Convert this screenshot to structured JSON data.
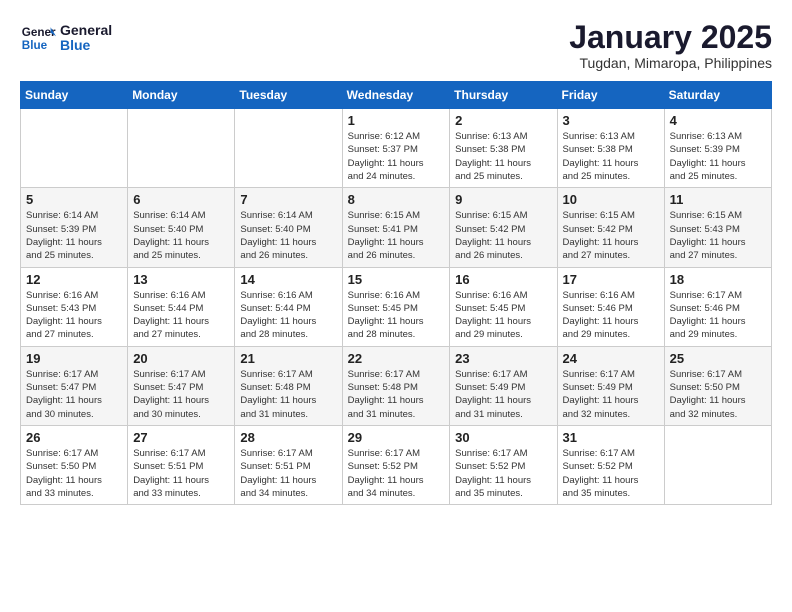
{
  "header": {
    "logo_line1": "General",
    "logo_line2": "Blue",
    "calendar_title": "January 2025",
    "calendar_subtitle": "Tugdan, Mimaropa, Philippines"
  },
  "weekdays": [
    "Sunday",
    "Monday",
    "Tuesday",
    "Wednesday",
    "Thursday",
    "Friday",
    "Saturday"
  ],
  "weeks": [
    [
      {
        "day": "",
        "info": ""
      },
      {
        "day": "",
        "info": ""
      },
      {
        "day": "",
        "info": ""
      },
      {
        "day": "1",
        "info": "Sunrise: 6:12 AM\nSunset: 5:37 PM\nDaylight: 11 hours\nand 24 minutes."
      },
      {
        "day": "2",
        "info": "Sunrise: 6:13 AM\nSunset: 5:38 PM\nDaylight: 11 hours\nand 25 minutes."
      },
      {
        "day": "3",
        "info": "Sunrise: 6:13 AM\nSunset: 5:38 PM\nDaylight: 11 hours\nand 25 minutes."
      },
      {
        "day": "4",
        "info": "Sunrise: 6:13 AM\nSunset: 5:39 PM\nDaylight: 11 hours\nand 25 minutes."
      }
    ],
    [
      {
        "day": "5",
        "info": "Sunrise: 6:14 AM\nSunset: 5:39 PM\nDaylight: 11 hours\nand 25 minutes."
      },
      {
        "day": "6",
        "info": "Sunrise: 6:14 AM\nSunset: 5:40 PM\nDaylight: 11 hours\nand 25 minutes."
      },
      {
        "day": "7",
        "info": "Sunrise: 6:14 AM\nSunset: 5:40 PM\nDaylight: 11 hours\nand 26 minutes."
      },
      {
        "day": "8",
        "info": "Sunrise: 6:15 AM\nSunset: 5:41 PM\nDaylight: 11 hours\nand 26 minutes."
      },
      {
        "day": "9",
        "info": "Sunrise: 6:15 AM\nSunset: 5:42 PM\nDaylight: 11 hours\nand 26 minutes."
      },
      {
        "day": "10",
        "info": "Sunrise: 6:15 AM\nSunset: 5:42 PM\nDaylight: 11 hours\nand 27 minutes."
      },
      {
        "day": "11",
        "info": "Sunrise: 6:15 AM\nSunset: 5:43 PM\nDaylight: 11 hours\nand 27 minutes."
      }
    ],
    [
      {
        "day": "12",
        "info": "Sunrise: 6:16 AM\nSunset: 5:43 PM\nDaylight: 11 hours\nand 27 minutes."
      },
      {
        "day": "13",
        "info": "Sunrise: 6:16 AM\nSunset: 5:44 PM\nDaylight: 11 hours\nand 27 minutes."
      },
      {
        "day": "14",
        "info": "Sunrise: 6:16 AM\nSunset: 5:44 PM\nDaylight: 11 hours\nand 28 minutes."
      },
      {
        "day": "15",
        "info": "Sunrise: 6:16 AM\nSunset: 5:45 PM\nDaylight: 11 hours\nand 28 minutes."
      },
      {
        "day": "16",
        "info": "Sunrise: 6:16 AM\nSunset: 5:45 PM\nDaylight: 11 hours\nand 29 minutes."
      },
      {
        "day": "17",
        "info": "Sunrise: 6:16 AM\nSunset: 5:46 PM\nDaylight: 11 hours\nand 29 minutes."
      },
      {
        "day": "18",
        "info": "Sunrise: 6:17 AM\nSunset: 5:46 PM\nDaylight: 11 hours\nand 29 minutes."
      }
    ],
    [
      {
        "day": "19",
        "info": "Sunrise: 6:17 AM\nSunset: 5:47 PM\nDaylight: 11 hours\nand 30 minutes."
      },
      {
        "day": "20",
        "info": "Sunrise: 6:17 AM\nSunset: 5:47 PM\nDaylight: 11 hours\nand 30 minutes."
      },
      {
        "day": "21",
        "info": "Sunrise: 6:17 AM\nSunset: 5:48 PM\nDaylight: 11 hours\nand 31 minutes."
      },
      {
        "day": "22",
        "info": "Sunrise: 6:17 AM\nSunset: 5:48 PM\nDaylight: 11 hours\nand 31 minutes."
      },
      {
        "day": "23",
        "info": "Sunrise: 6:17 AM\nSunset: 5:49 PM\nDaylight: 11 hours\nand 31 minutes."
      },
      {
        "day": "24",
        "info": "Sunrise: 6:17 AM\nSunset: 5:49 PM\nDaylight: 11 hours\nand 32 minutes."
      },
      {
        "day": "25",
        "info": "Sunrise: 6:17 AM\nSunset: 5:50 PM\nDaylight: 11 hours\nand 32 minutes."
      }
    ],
    [
      {
        "day": "26",
        "info": "Sunrise: 6:17 AM\nSunset: 5:50 PM\nDaylight: 11 hours\nand 33 minutes."
      },
      {
        "day": "27",
        "info": "Sunrise: 6:17 AM\nSunset: 5:51 PM\nDaylight: 11 hours\nand 33 minutes."
      },
      {
        "day": "28",
        "info": "Sunrise: 6:17 AM\nSunset: 5:51 PM\nDaylight: 11 hours\nand 34 minutes."
      },
      {
        "day": "29",
        "info": "Sunrise: 6:17 AM\nSunset: 5:52 PM\nDaylight: 11 hours\nand 34 minutes."
      },
      {
        "day": "30",
        "info": "Sunrise: 6:17 AM\nSunset: 5:52 PM\nDaylight: 11 hours\nand 35 minutes."
      },
      {
        "day": "31",
        "info": "Sunrise: 6:17 AM\nSunset: 5:52 PM\nDaylight: 11 hours\nand 35 minutes."
      },
      {
        "day": "",
        "info": ""
      }
    ]
  ]
}
